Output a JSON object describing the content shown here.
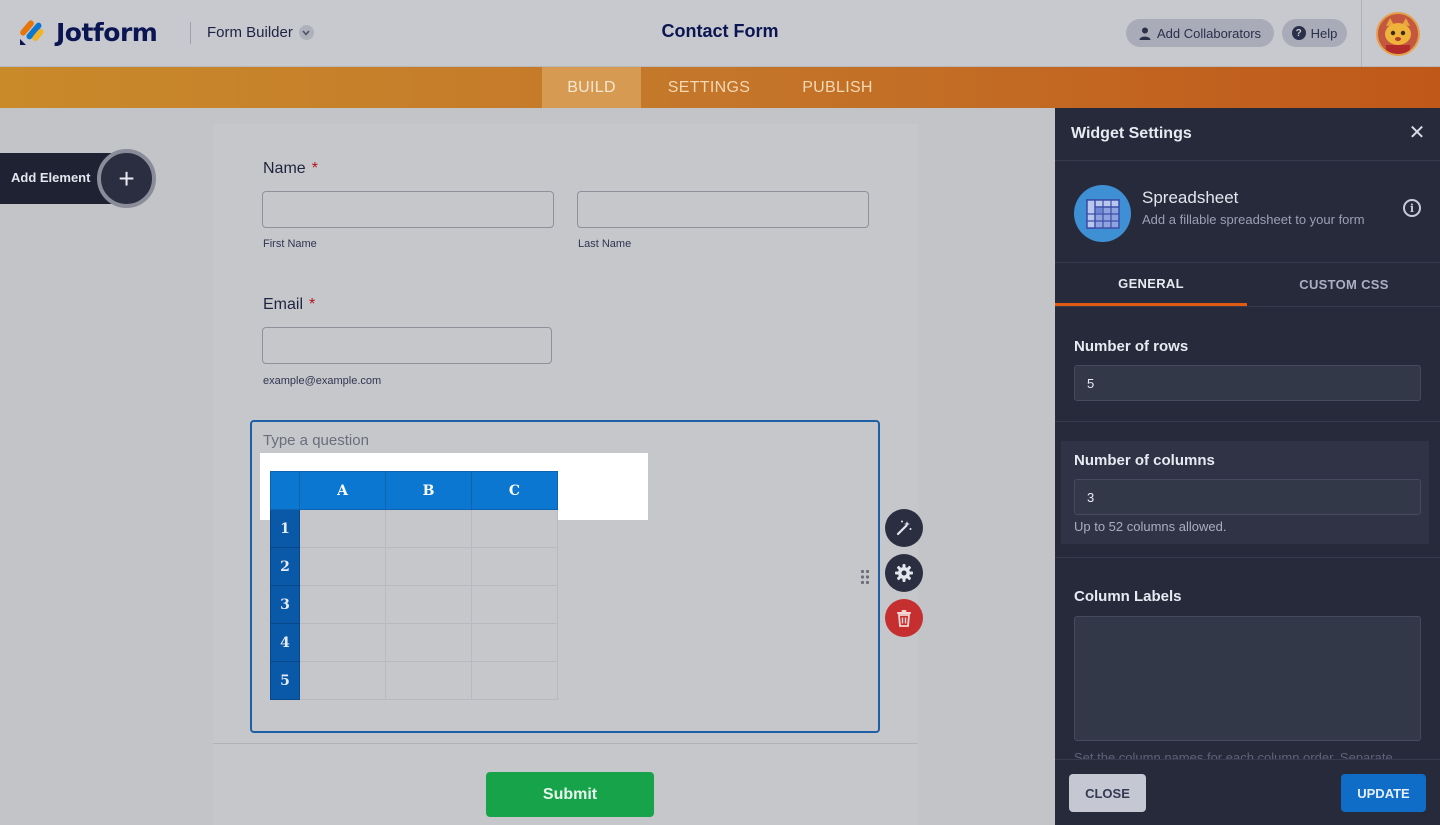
{
  "header": {
    "logo_text": "Jotform",
    "form_builder_label": "Form Builder",
    "form_title": "Contact Form",
    "add_collaborators_label": "Add Collaborators",
    "help_label": "Help",
    "help_glyph": "?"
  },
  "nav": {
    "tabs": [
      {
        "label": "BUILD",
        "active": true
      },
      {
        "label": "SETTINGS",
        "active": false
      },
      {
        "label": "PUBLISH",
        "active": false
      }
    ]
  },
  "sidebar": {
    "add_element_label": "Add Element",
    "add_element_glyph": "+"
  },
  "form": {
    "name_question": {
      "label": "Name",
      "required_mark": "*",
      "first_sublabel": "First Name",
      "last_sublabel": "Last Name"
    },
    "email_question": {
      "label": "Email",
      "required_mark": "*",
      "sublabel": "example@example.com"
    },
    "spreadsheet_question": {
      "placeholder": "Type a question",
      "columns": [
        "A",
        "B",
        "C"
      ],
      "rows": [
        "1",
        "2",
        "3",
        "4",
        "5"
      ]
    },
    "submit_label": "Submit"
  },
  "panel": {
    "title": "Widget Settings",
    "close_glyph": "✕",
    "widget_name": "Spreadsheet",
    "widget_description": "Add a fillable spreadsheet to your form",
    "info_glyph": "i",
    "tabs": [
      {
        "label": "GENERAL",
        "active": true
      },
      {
        "label": "CUSTOM CSS",
        "active": false
      }
    ],
    "rows_label": "Number of rows",
    "rows_value": "5",
    "columns_label": "Number of columns",
    "columns_value": "3",
    "columns_help": "Up to 52 columns allowed.",
    "column_labels_label": "Column Labels",
    "column_labels_help": "Set the column names for each column order. Separate",
    "close_button": "CLOSE",
    "update_button": "UPDATE"
  },
  "colors": {
    "accent_orange": "#e05a12",
    "primary_blue": "#0b77d0",
    "submit_green": "#17a34a",
    "delete_red": "#c62f2f"
  },
  "icons": [
    "jotform-logo-icon",
    "chevron-down-icon",
    "user-icon",
    "help-icon",
    "avatar",
    "plus-icon",
    "magic-wand-icon",
    "gear-icon",
    "trash-icon",
    "drag-handle-icon",
    "close-icon",
    "spreadsheet-icon",
    "info-icon"
  ]
}
